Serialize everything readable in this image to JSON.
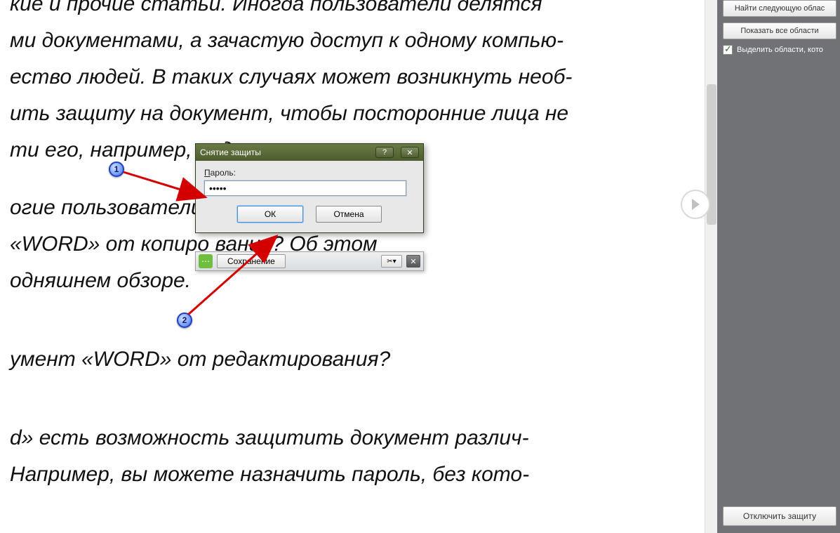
{
  "document": {
    "p1": "кие и прочие статьи. Иногда пользователи делятся",
    "p2": "ми документами, а зачастую доступ к одному компью-",
    "p3": "ество людей. В таких случаях может возникнуть необ-",
    "p4": "ить защиту на документ, чтобы посторонние лица не",
    "p5": "ти его, например, редактировать",
    "p6": "огие пользователи                                    ак следует защи-",
    "p7": "«WORD» от копиро                                   вания? Об этом",
    "p8": "одняшнем обзоре.",
    "p9": "умент «WORD» от редактирования?",
    "p10": "d» есть возможность защитить документ различ-",
    "p11": " Например, вы можете назначить пароль, без кото-"
  },
  "dialog": {
    "title": "Снятие защиты",
    "password_label_underline": "П",
    "password_label_rest": "ароль:",
    "password_value": "•••••",
    "ok": "ОК",
    "cancel": "Отмена",
    "help_symbol": "?",
    "close_symbol": "✕"
  },
  "savebar": {
    "icon_glyph": "⋯",
    "button": "Сохранение",
    "tool_glyph": "✂▾",
    "close_glyph": "✕"
  },
  "side_panel": {
    "btn_find_next": "Найти следующую облас",
    "btn_show_all": "Показать все области",
    "checkbox_label": "Выделить области, кото",
    "btn_disable": "Отключить защиту"
  },
  "scroll_hint": "▶",
  "annotations": {
    "marker1": "1",
    "marker2": "2"
  }
}
